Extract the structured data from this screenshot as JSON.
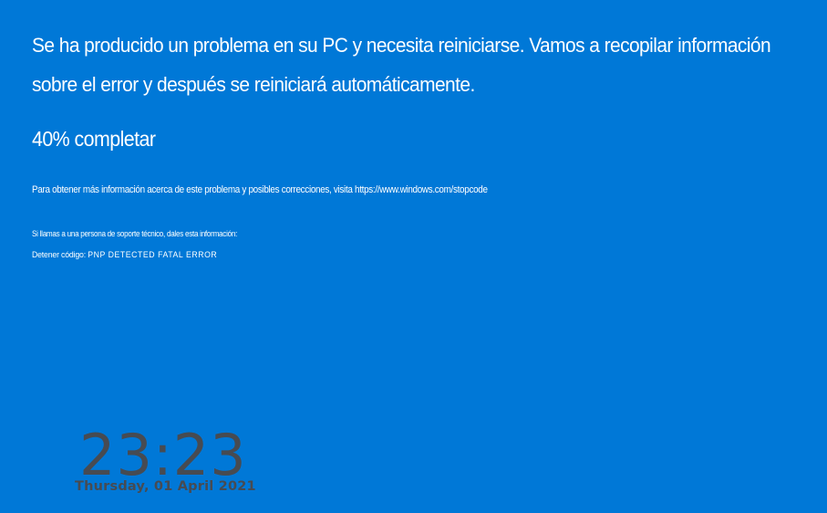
{
  "bsod": {
    "message_line1": "Se ha producido un problema en su PC y necesita reiniciarse. Vamos a recopilar información",
    "message_line2": "sobre el error y después se reiniciará automáticamente.",
    "progress_text": "40% completar",
    "progress_percent": 40,
    "info_text": "Para obtener más información acerca de este problema y posibles correcciones, visita https://www.windows.com/stopcode",
    "support_text": "Si llamas a una persona de soporte técnico, dales esta información:",
    "stop_code_label": "Detener código: ",
    "stop_code": "PNP DETECTED FATAL ERROR"
  },
  "clock": {
    "time": "23:23",
    "date": "Thursday, 01 April 2021"
  },
  "colors": {
    "background": "#0078d7",
    "text": "#ffffff",
    "clock": "#474b52"
  }
}
